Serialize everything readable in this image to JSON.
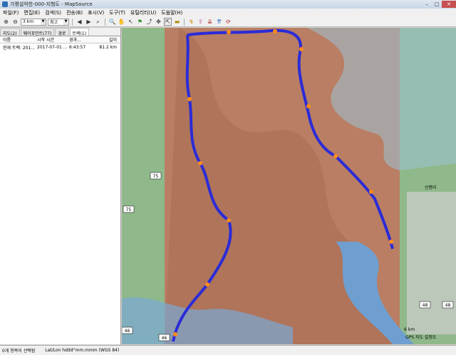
{
  "window": {
    "title": "가평설악한-000-지형도 - MapSource"
  },
  "menu": [
    "파일(F)",
    "편집(E)",
    "검색(S)",
    "전송(B)",
    "표시(V)",
    "도구(T)",
    "유틸리티(U)",
    "도움말(H)"
  ],
  "toolbar": {
    "scale_value": "3 km",
    "detail_value": "최고"
  },
  "left_tabs": [
    "지도(2)",
    "웨이포인트(77)",
    "경로",
    "트랙(1)"
  ],
  "track_columns": [
    "이름",
    "시작 시간",
    "경과...",
    "길이"
  ],
  "track_rows": [
    {
      "name": "현재 트랙: 201...",
      "start": "2017-07-01 ...",
      "elapsed": "6:43:57",
      "length": "81.2 km"
    }
  ],
  "status": {
    "selection": "0개 항목이 선택됨",
    "format": "Lat/Lon hddd°mm.mmm (WGS 84)"
  },
  "map_labels": [
    "75",
    "75",
    "46",
    "46",
    "48",
    "48",
    "6 km",
    "GPS 지도 설정도",
    "신평리"
  ],
  "colors": {
    "track": "#2b2bd8",
    "terrain": "#b8735a",
    "water": "#6f9fd0",
    "forest": "#8fb98a"
  }
}
